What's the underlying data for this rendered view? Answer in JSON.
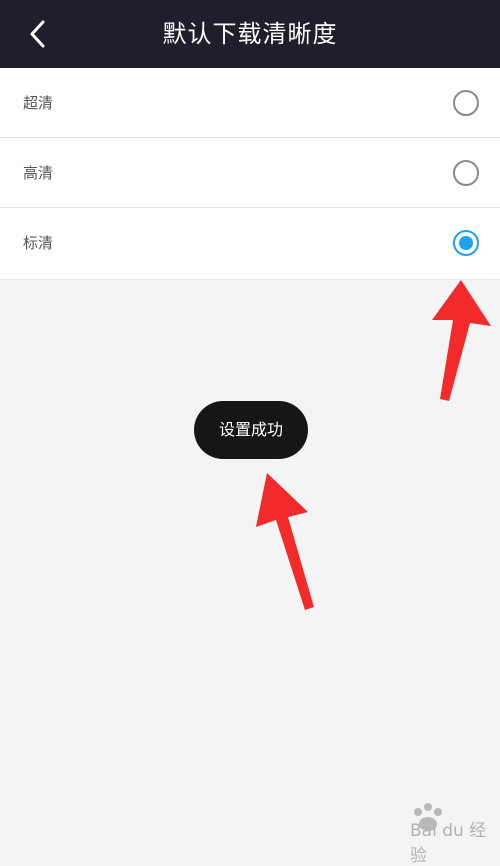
{
  "header": {
    "title": "默认下载清晰度",
    "back_icon": "chevron-left-icon"
  },
  "options": [
    {
      "label": "超清",
      "selected": false
    },
    {
      "label": "高清",
      "selected": false
    },
    {
      "label": "标清",
      "selected": true
    }
  ],
  "toast": {
    "text": "设置成功"
  },
  "colors": {
    "header_bg": "#1f1e2a",
    "page_bg": "#f5f4f4",
    "accent": "#1aa3f0",
    "annotation_arrow": "#f22a2a"
  },
  "watermark": {
    "text": "Bai du 经验"
  }
}
